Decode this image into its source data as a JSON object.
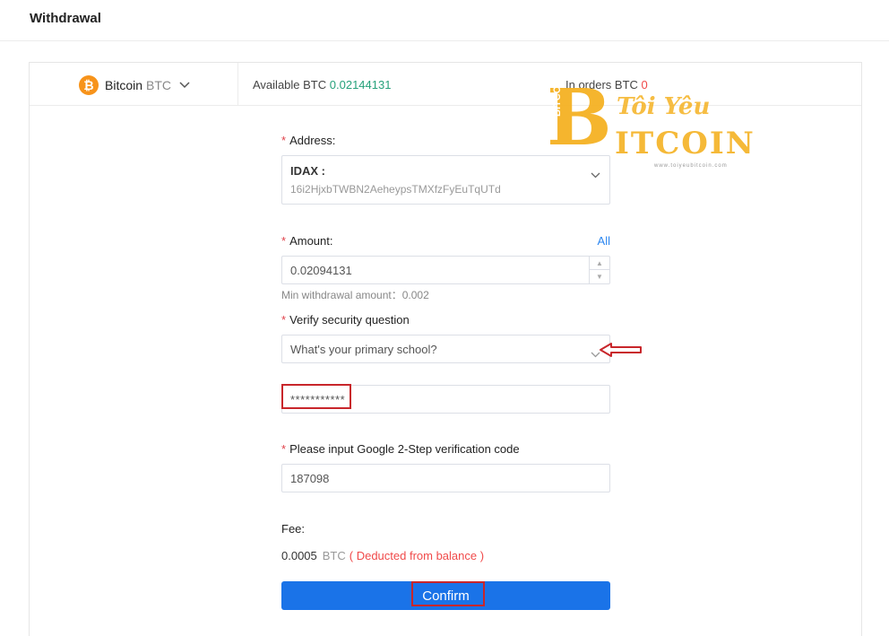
{
  "page": {
    "title": "Withdrawal"
  },
  "coin": {
    "name": "Bitcoin",
    "symbol": "BTC",
    "logo_glyph": "₿"
  },
  "balance": {
    "available_label": "Available BTC",
    "available_value": "0.02144131",
    "orders_label": "In orders BTC",
    "orders_value": "0"
  },
  "address": {
    "label": "Address",
    "exchange": "IDAX :",
    "value": "16i2HjxbTWBN2AeheypsTMXfzFyEuTqUTd"
  },
  "amount": {
    "label": "Amount:",
    "all_label": "All",
    "value": "0.02094131",
    "min_hint": "Min withdrawal amount：0.002"
  },
  "security": {
    "label": "Verify security question",
    "question": "What's your primary school?",
    "answer": "***********"
  },
  "google_2fa": {
    "label": "Please input Google 2-Step verification code",
    "value": "187098"
  },
  "fee": {
    "label": "Fee:",
    "value": "0.0005",
    "unit": "BTC",
    "note": "( Deducted from balance )"
  },
  "confirm_label": "Confirm",
  "watermark": {
    "big_letter": "B",
    "top_text": "Tôi Yêu",
    "main_text": "ITCOIN",
    "side_text": "BITCOIN",
    "url": "www.toiyeubitcoin.com"
  },
  "colors": {
    "accent": "#1a73e8",
    "positive": "#26a17b",
    "negative": "#f04a4a",
    "highlight": "#c8262b",
    "brand_orange": "#f7931a"
  }
}
